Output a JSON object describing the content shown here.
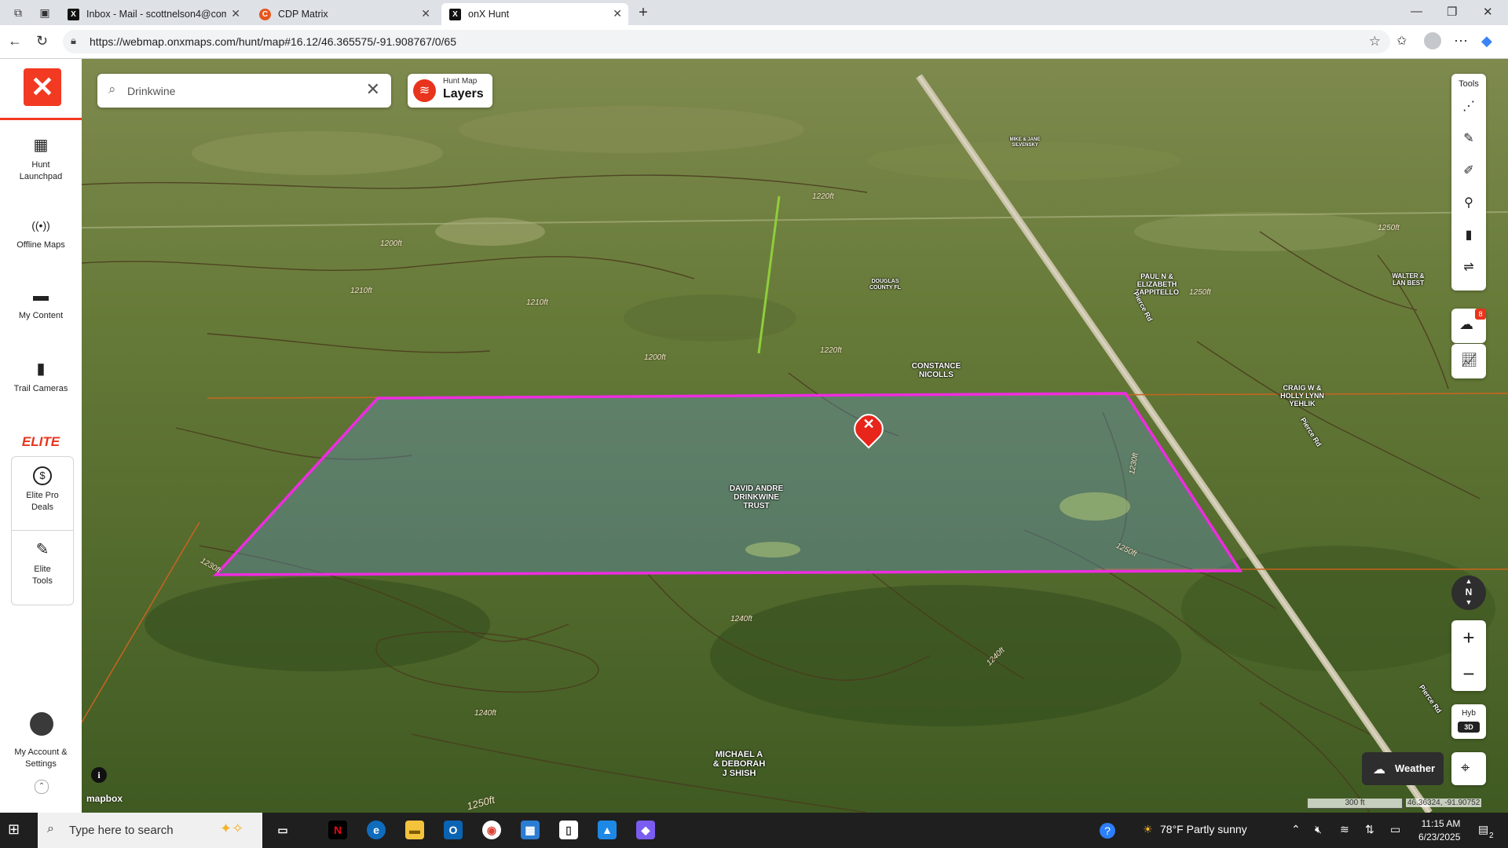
{
  "browser": {
    "tabs": [
      {
        "title": "Inbox - Mail - scottnelson4@com",
        "favicon": "X",
        "active": false
      },
      {
        "title": "CDP Matrix",
        "favicon": "C",
        "active": false
      },
      {
        "title": "onX Hunt",
        "favicon": "X",
        "active": true
      }
    ],
    "url": "https://webmap.onxmaps.com/hunt/map#16.12/46.365575/-91.908767/0/65"
  },
  "sidebar": {
    "items": [
      {
        "label": "Hunt Launchpad",
        "icon": "grid-icon"
      },
      {
        "label": "Offline Maps",
        "icon": "offline-icon"
      },
      {
        "label": "My Content",
        "icon": "folder-icon"
      },
      {
        "label": "Trail Cameras",
        "icon": "camera-icon"
      }
    ],
    "elite_label": "ELITE",
    "elite_items": [
      {
        "label": "Elite Pro Deals",
        "icon": "dollar-icon"
      },
      {
        "label": "Elite Tools",
        "icon": "tools-icon"
      }
    ],
    "account_label": "My Account & Settings"
  },
  "search": {
    "value": "Drinkwine",
    "placeholder": "Search"
  },
  "layers": {
    "small": "Hunt Map",
    "big": "Layers"
  },
  "tools": {
    "label": "Tools",
    "badge": "8"
  },
  "map": {
    "owners": [
      {
        "name": "DAVID ANDRE DRINKWINE TRUST"
      },
      {
        "name": "CONSTANCE NICOLLS"
      },
      {
        "name": "DOUGLAS COUNTY FL"
      },
      {
        "name": "PAUL N & ELIZABETH ZAPPITELLO"
      },
      {
        "name": "WALTER & LAN BEST"
      },
      {
        "name": "CRAIG W & HOLLY LYNN YEHLIK"
      },
      {
        "name": "MIKE & JANE SILVENSKY"
      },
      {
        "name": "MICHAEL A & DEBORAH J SHISH"
      }
    ],
    "road_label": "Pierce Rd",
    "elevations": [
      "1200ft",
      "1210ft",
      "1220ft",
      "1230ft",
      "1240ft",
      "1250ft"
    ],
    "scale": "300 ft",
    "coords": "46.36324, -91.90752",
    "mode": "Hyb",
    "mode_3d": "3D",
    "weather_label": "Weather",
    "compass": "N",
    "attribution": "mapbox"
  },
  "taskbar": {
    "search_placeholder": "Type here to search",
    "weather": "78°F  Partly sunny",
    "time": "11:15 AM",
    "date": "6/23/2025",
    "notification_count": "2"
  },
  "colors": {
    "accent": "#e8341c",
    "parcel": "#ee2ce0"
  }
}
